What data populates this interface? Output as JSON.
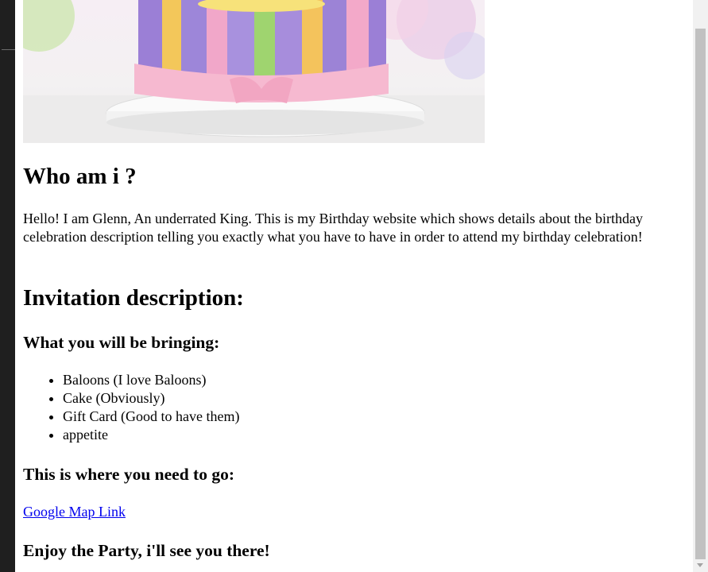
{
  "hero": {
    "image_name": "birthday-cake-image"
  },
  "about": {
    "title": "Who am i ?",
    "text": "Hello! I am Glenn, An underrated King. This is my Birthday website which shows details about the birthday celebration description telling you exactly what you have to have in order to attend my birthday celebration!"
  },
  "invitation": {
    "title": "Invitation description:",
    "bring_title": "What you will be bringing:",
    "bring_items": [
      "Baloons (I love Baloons)",
      "Cake (Obviously)",
      "Gift Card (Good to have them)",
      "appetite"
    ],
    "go_title": "This is where you need to go:",
    "map_link_label": "Google Map Link",
    "closing": "Enjoy the Party, i'll see you there!"
  },
  "colors": {
    "link": "#0000ee",
    "left_strip": "#1f1f1f",
    "scrollbar_thumb": "#c1c1c1"
  },
  "icons": {
    "scroll_down": "scroll-down-arrow-icon"
  }
}
